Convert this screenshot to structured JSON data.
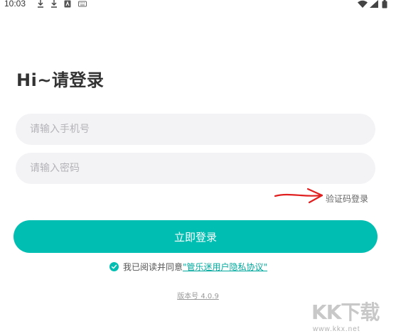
{
  "status_bar": {
    "time": "10:03",
    "icons": [
      "download-icon",
      "download-icon",
      "app-notification-icon",
      "keyboard-icon",
      "wifi-icon",
      "signal-icon",
      "battery-icon"
    ]
  },
  "login": {
    "title": "Hi~请登录",
    "phone_placeholder": "请输入手机号",
    "password_placeholder": "请输入密码",
    "sms_login_label": "验证码登录",
    "login_button_label": "立即登录",
    "agreement_prefix": "我已阅读并同意",
    "agreement_link": "\"管乐迷用户隐私协议\"",
    "agreement_checked": true,
    "version": "版本号 4.0.9"
  },
  "colors": {
    "accent": "#00bfb2",
    "annotation_arrow": "#e02020"
  },
  "watermark": {
    "logo_text": "KK下载",
    "url": "www.kkx.net"
  }
}
